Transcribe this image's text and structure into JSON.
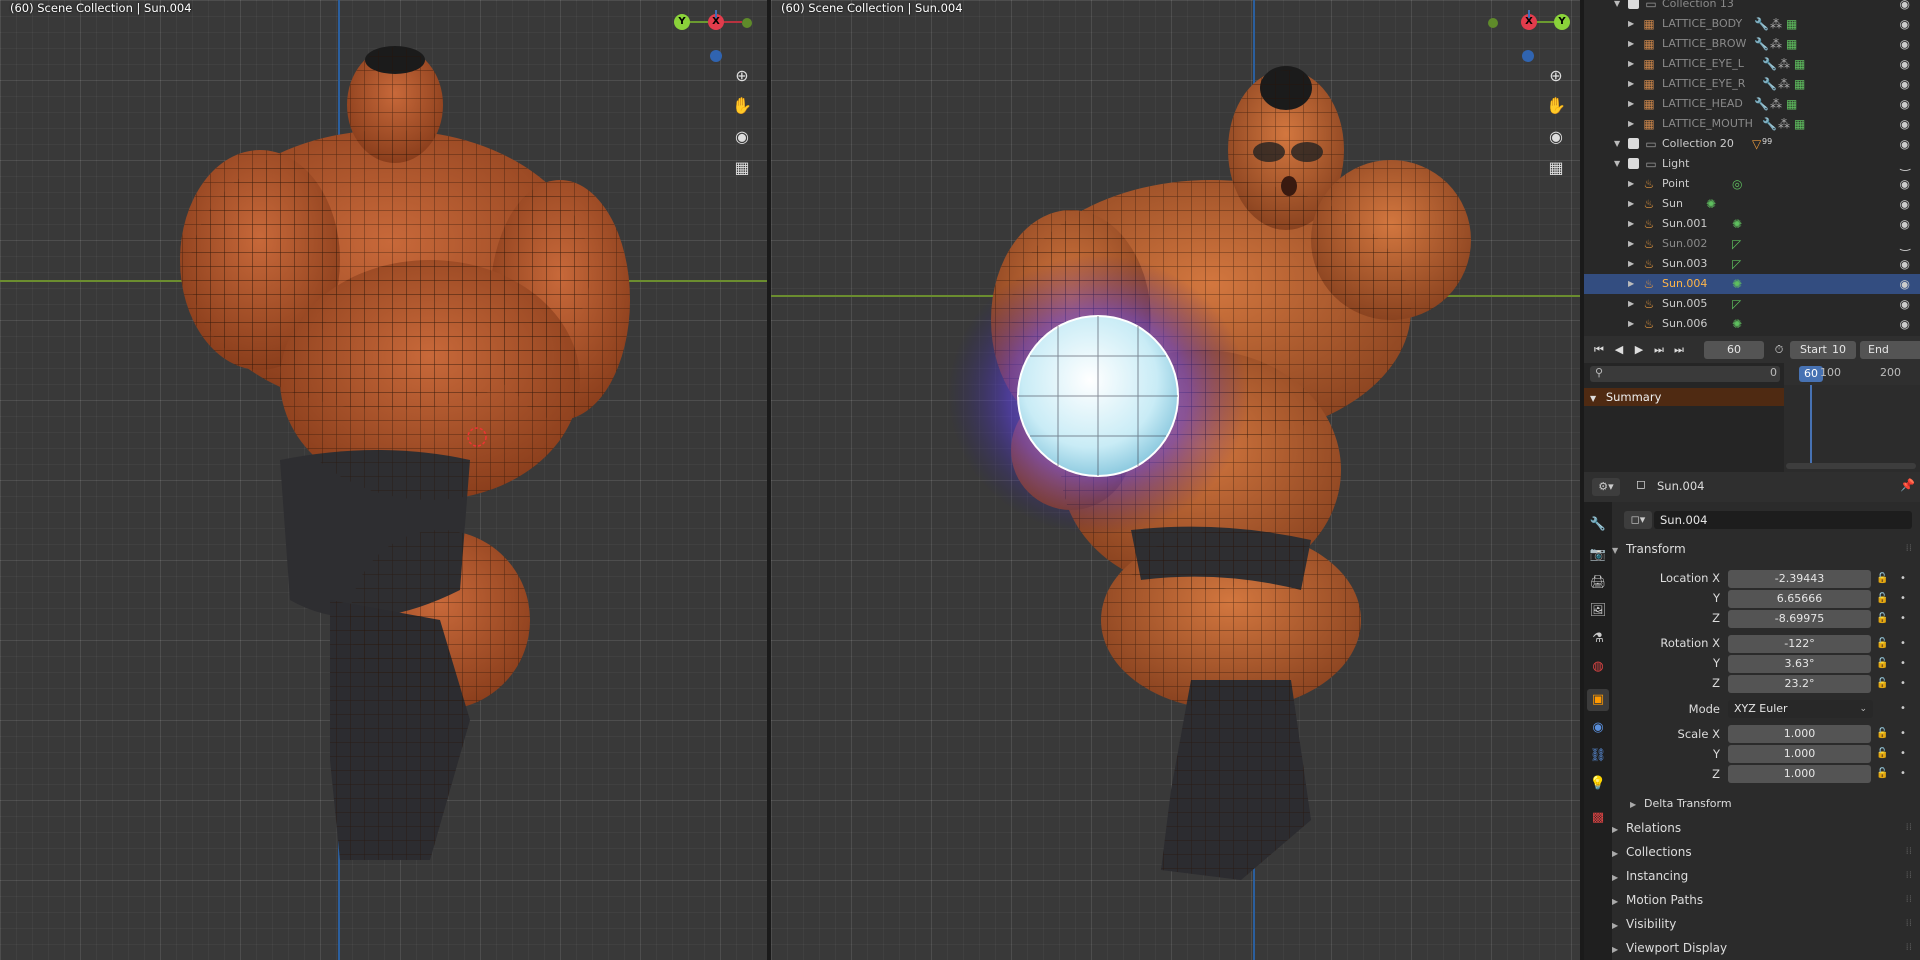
{
  "viewport_left": {
    "title": "(60) Scene Collection | Sun.004",
    "gizmo": {
      "y": "Y",
      "x": "X"
    }
  },
  "viewport_right": {
    "title": "(60) Scene Collection | Sun.004",
    "gizmo": {
      "y": "Y",
      "x": "X"
    }
  },
  "outliner": {
    "rows": [
      {
        "label": "Collection 13",
        "kind": "collection",
        "dim": true
      },
      {
        "label": "LATTICE_BODY",
        "kind": "lattice"
      },
      {
        "label": "LATTICE_BROW",
        "kind": "lattice"
      },
      {
        "label": "LATTICE_EYE_L",
        "kind": "lattice"
      },
      {
        "label": "LATTICE_EYE_R",
        "kind": "lattice"
      },
      {
        "label": "LATTICE_HEAD",
        "kind": "lattice"
      },
      {
        "label": "LATTICE_MOUTH",
        "kind": "lattice"
      },
      {
        "label": "Collection 20",
        "kind": "collection",
        "badge": "99"
      },
      {
        "label": "Light",
        "kind": "collection"
      },
      {
        "label": "Point",
        "kind": "light"
      },
      {
        "label": "Sun",
        "kind": "light"
      },
      {
        "label": "Sun.001",
        "kind": "light"
      },
      {
        "label": "Sun.002",
        "kind": "light",
        "dim": true
      },
      {
        "label": "Sun.003",
        "kind": "light"
      },
      {
        "label": "Sun.004",
        "kind": "light",
        "selected": true
      },
      {
        "label": "Sun.005",
        "kind": "light"
      },
      {
        "label": "Sun.006",
        "kind": "light"
      }
    ]
  },
  "timeline": {
    "current_frame": "60",
    "start_label": "Start",
    "start_value": "10",
    "end_label": "End",
    "ruler": [
      "0",
      "60",
      "100",
      "200"
    ],
    "summary": "Summary"
  },
  "properties": {
    "header_object": "Sun.004",
    "name_field": "Sun.004",
    "transform_label": "Transform",
    "location_label": "Location X",
    "location": {
      "x": "-2.39443",
      "y": "6.65666",
      "z": "-8.69975"
    },
    "rotation_label": "Rotation X",
    "rotation": {
      "x": "-122°",
      "y": "3.63°",
      "z": "23.2°"
    },
    "mode_label": "Mode",
    "mode_value": "XYZ Euler",
    "scale_label": "Scale X",
    "scale": {
      "x": "1.000",
      "y": "1.000",
      "z": "1.000"
    },
    "y_label": "Y",
    "z_label": "Z",
    "panels": [
      "Delta Transform",
      "Relations",
      "Collections",
      "Instancing",
      "Motion Paths",
      "Visibility",
      "Viewport Display"
    ]
  }
}
